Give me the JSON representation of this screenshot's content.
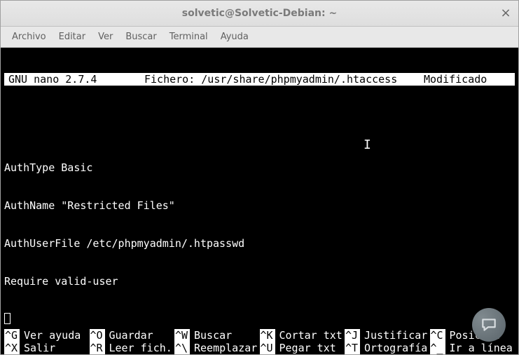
{
  "window": {
    "title": "solvetic@Solvetic-Debian: ~"
  },
  "menubar": {
    "items": [
      "Archivo",
      "Editar",
      "Ver",
      "Buscar",
      "Terminal",
      "Ayuda"
    ]
  },
  "nano": {
    "app": "GNU nano 2.7.4",
    "file_label": "Fichero: /usr/share/phpmyadmin/.htaccess",
    "status": "Modificado"
  },
  "editor": {
    "lines": [
      "AuthType Basic",
      "AuthName \"Restricted Files\"",
      "AuthUserFile /etc/phpmyadmin/.htpasswd",
      "Require valid-user"
    ]
  },
  "shortcuts": {
    "row1": [
      {
        "key": "^G",
        "label": "Ver ayuda"
      },
      {
        "key": "^O",
        "label": "Guardar"
      },
      {
        "key": "^W",
        "label": "Buscar"
      },
      {
        "key": "^K",
        "label": "Cortar txt"
      },
      {
        "key": "^J",
        "label": "Justificar"
      },
      {
        "key": "^C",
        "label": "Posición"
      }
    ],
    "row2": [
      {
        "key": "^X",
        "label": "Salir"
      },
      {
        "key": "^R",
        "label": "Leer fich."
      },
      {
        "key": "^\\",
        "label": "Reemplazar"
      },
      {
        "key": "^U",
        "label": "Pegar txt"
      },
      {
        "key": "^T",
        "label": "Ortografía"
      },
      {
        "key": "^_",
        "label": "Ir a línea"
      }
    ]
  }
}
